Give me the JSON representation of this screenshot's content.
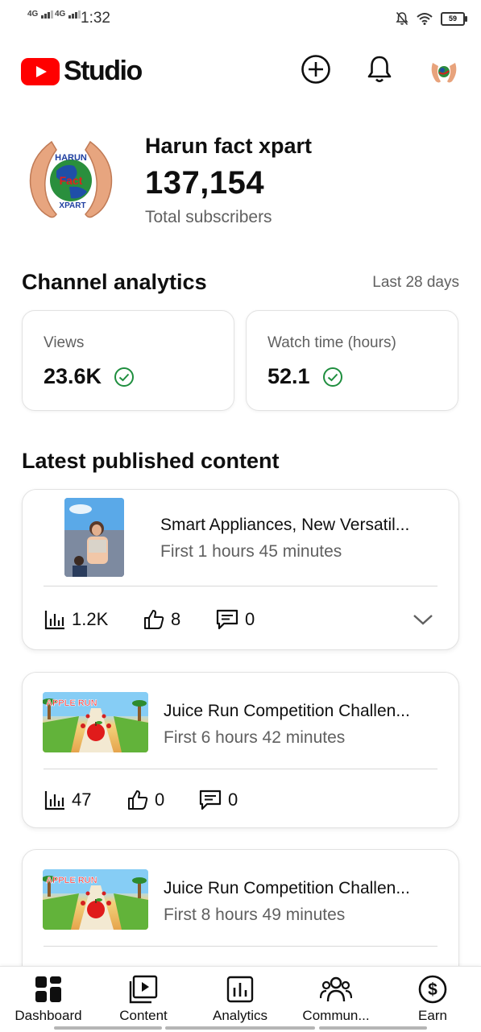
{
  "status_bar": {
    "signal1": "4G",
    "signal2": "4G",
    "time": "1:32",
    "battery": "59"
  },
  "app": {
    "logo_text": "Studio",
    "brand_color": "#ff0000"
  },
  "channel": {
    "name": "Harun fact xpart",
    "subscribers": "137,154",
    "subscribers_label": "Total subscribers",
    "avatar_text_top": "HARUN",
    "avatar_text_mid": "Fact",
    "avatar_text_bottom": "XPART"
  },
  "analytics": {
    "title": "Channel analytics",
    "range": "Last 28 days",
    "cards": [
      {
        "label": "Views",
        "value": "23.6K"
      },
      {
        "label": "Watch time (hours)",
        "value": "52.1"
      }
    ],
    "check_color": "#1e8e3e"
  },
  "latest": {
    "title": "Latest published content",
    "items": [
      {
        "title": "Smart Appliances, New Versatil...",
        "time": "First 1 hours 45 minutes",
        "views": "1.2K",
        "likes": "8",
        "comments": "0"
      },
      {
        "title": "Juice Run Competition Challen...",
        "time": "First 6 hours 42 minutes",
        "views": "47",
        "likes": "0",
        "comments": "0"
      },
      {
        "title": "Juice Run Competition Challen...",
        "time": "First 8 hours 49 minutes"
      }
    ],
    "thumb_text": "APPLE RUN"
  },
  "bottom_nav": [
    {
      "label": "Dashboard",
      "icon": "dashboard-icon"
    },
    {
      "label": "Content",
      "icon": "content-icon"
    },
    {
      "label": "Analytics",
      "icon": "analytics-icon"
    },
    {
      "label": "Commun...",
      "icon": "community-icon"
    },
    {
      "label": "Earn",
      "icon": "earn-icon"
    }
  ]
}
